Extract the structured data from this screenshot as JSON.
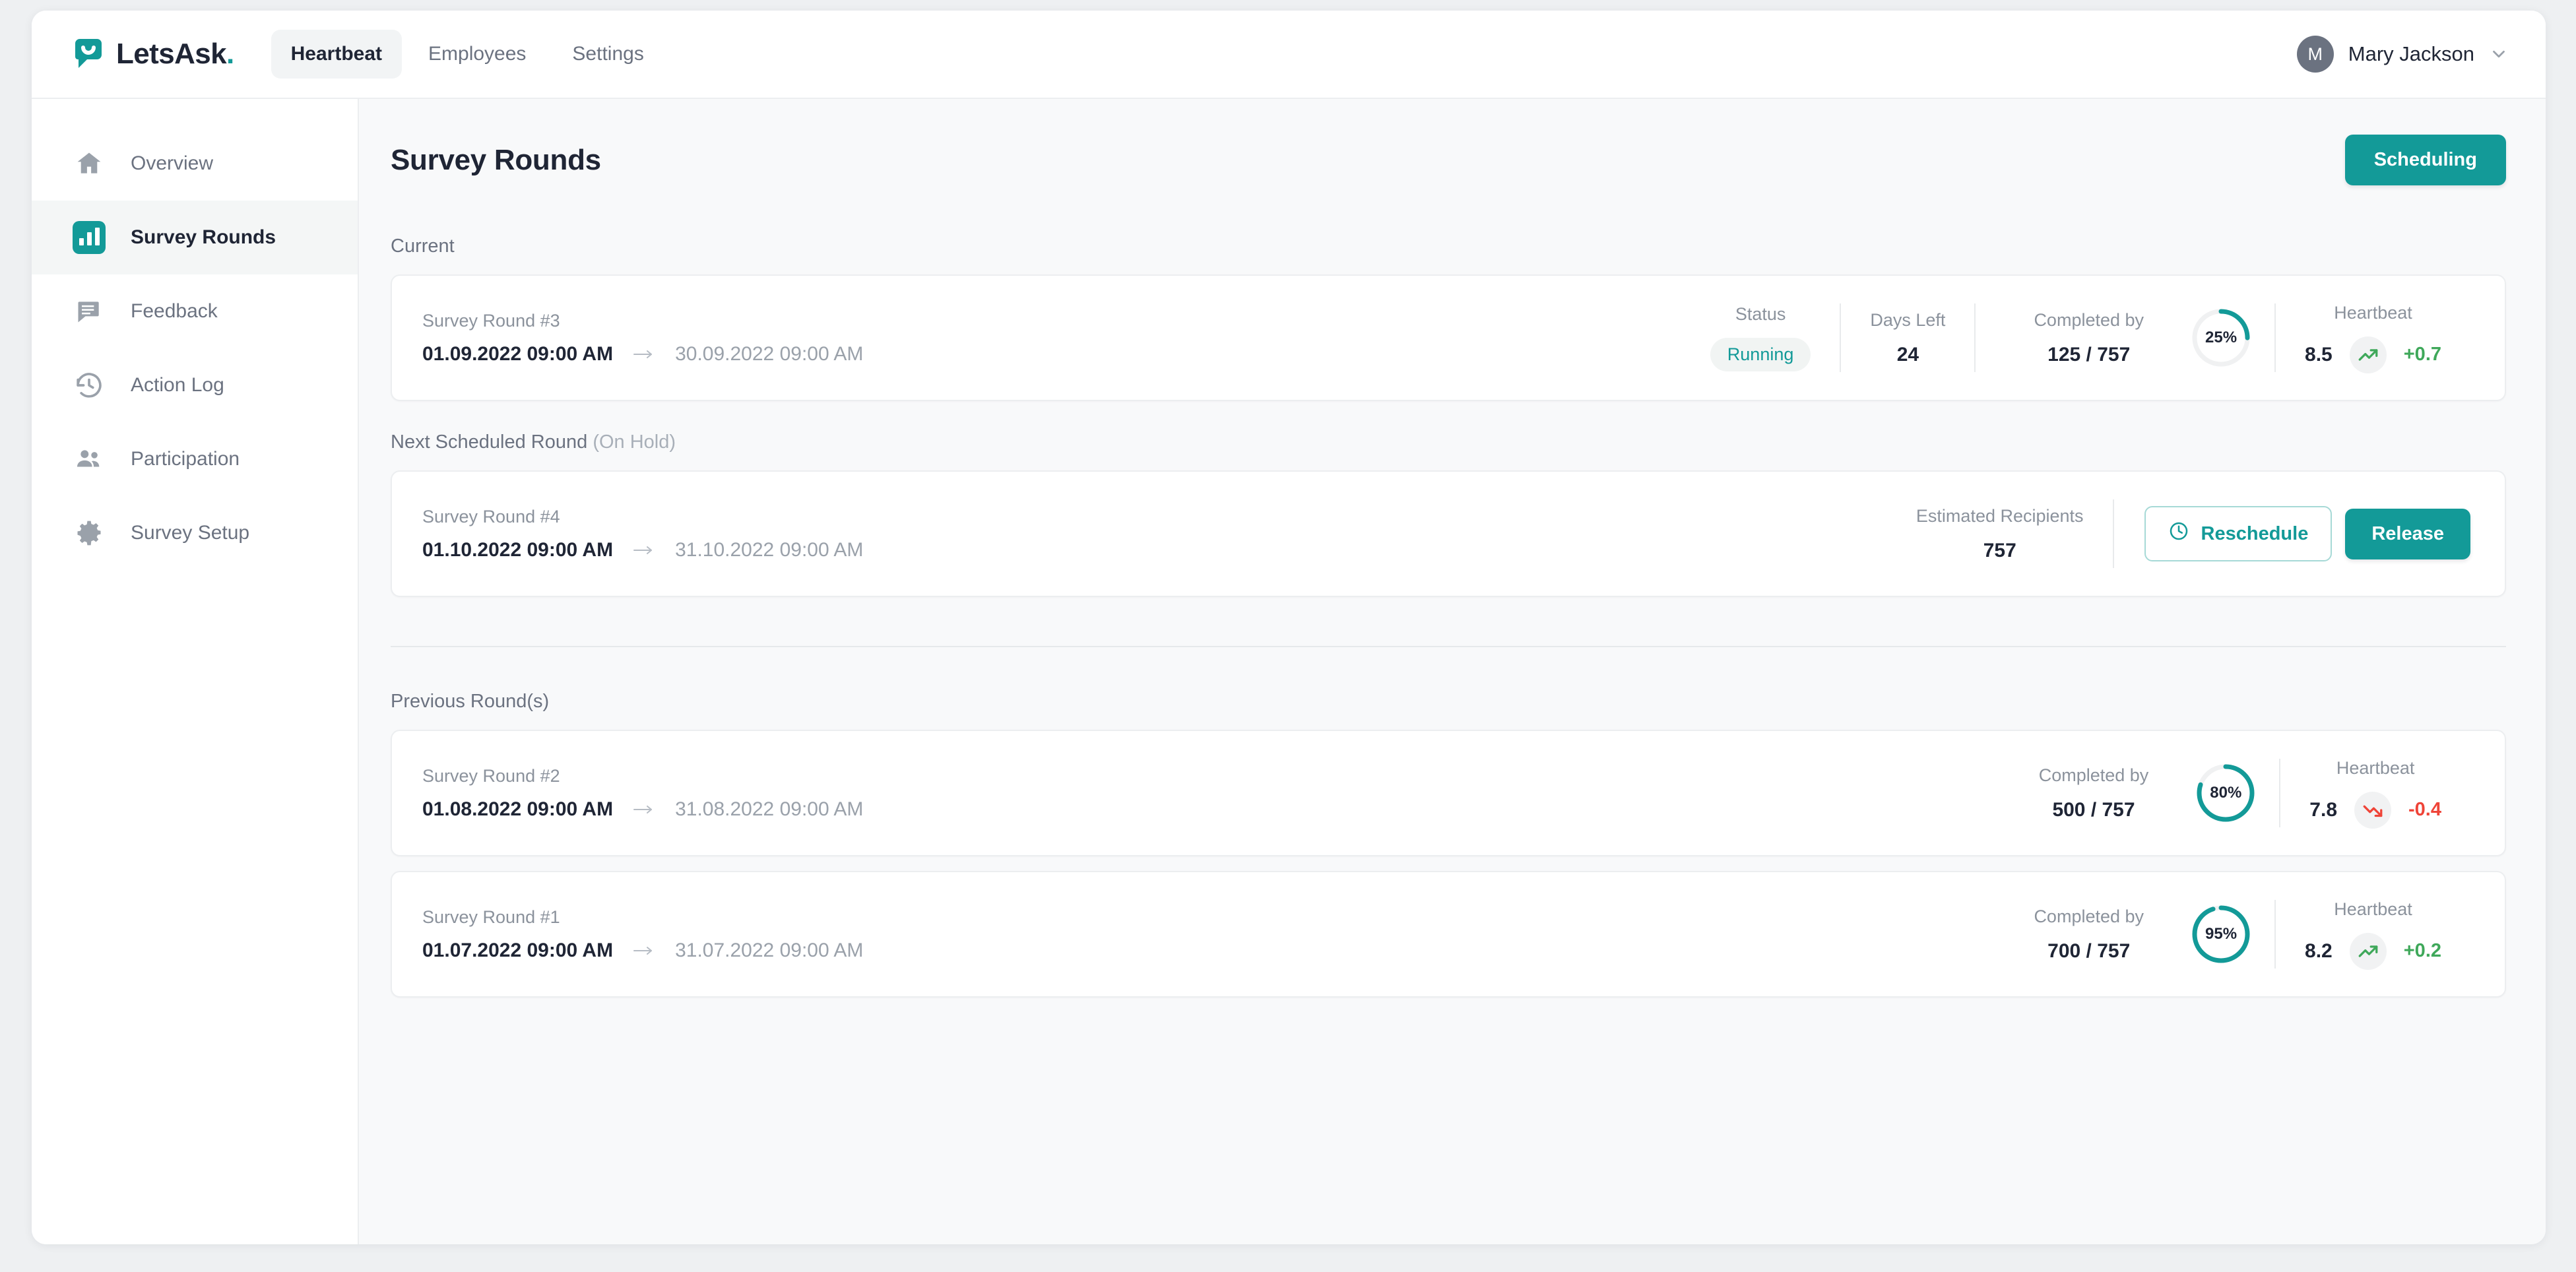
{
  "brand": {
    "name": "LetsAsk",
    "dot": ".",
    "logo_icon": "speech-bubble-smile-icon"
  },
  "nav": {
    "tabs": [
      {
        "label": "Heartbeat",
        "active": true
      },
      {
        "label": "Employees",
        "active": false
      },
      {
        "label": "Settings",
        "active": false
      }
    ]
  },
  "user": {
    "initial": "M",
    "name": "Mary Jackson",
    "chevron_icon": "chevron-down-icon"
  },
  "sidebar": {
    "items": [
      {
        "label": "Overview",
        "icon": "home-icon",
        "active": false
      },
      {
        "label": "Survey Rounds",
        "icon": "bar-chart-icon",
        "active": true
      },
      {
        "label": "Feedback",
        "icon": "comment-icon",
        "active": false
      },
      {
        "label": "Action Log",
        "icon": "history-clock-icon",
        "active": false
      },
      {
        "label": "Participation",
        "icon": "people-icon",
        "active": false
      },
      {
        "label": "Survey Setup",
        "icon": "gear-icon",
        "active": false
      }
    ]
  },
  "page": {
    "title": "Survey Rounds",
    "scheduling_button": "Scheduling"
  },
  "colors": {
    "accent_teal": "#139a98",
    "positive_green": "#3fa85a",
    "negative_red": "#ef4438",
    "track_gray": "#f0f1f2"
  },
  "sections": {
    "current": {
      "label": "Current",
      "round": {
        "name": "Survey Round #3",
        "date_from": "01.09.2022 09:00 AM",
        "date_to": "30.09.2022 09:00 AM",
        "arrow_icon": "arrow-right-icon",
        "status_label": "Status",
        "status_value": "Running",
        "days_left_label": "Days Left",
        "days_left_value": "24",
        "completed_label": "Completed by",
        "completed_value": "125 / 757",
        "completed_percent": 25,
        "completed_percent_text": "25%",
        "heartbeat_label": "Heartbeat",
        "heartbeat_value": "8.5",
        "heartbeat_delta": "+0.7",
        "heartbeat_trend": "up",
        "trend_icon": "trending-up-icon"
      }
    },
    "next": {
      "label": "Next Scheduled Round",
      "label_suffix": "(On Hold)",
      "round": {
        "name": "Survey Round #4",
        "date_from": "01.10.2022 09:00 AM",
        "date_to": "31.10.2022 09:00 AM",
        "arrow_icon": "arrow-right-icon",
        "recipients_label": "Estimated Recipients",
        "recipients_value": "757",
        "reschedule_button": "Reschedule",
        "reschedule_icon": "clock-icon",
        "release_button": "Release"
      }
    },
    "previous": {
      "label": "Previous Round(s)",
      "rounds": [
        {
          "name": "Survey Round #2",
          "date_from": "01.08.2022 09:00 AM",
          "date_to": "31.08.2022 09:00 AM",
          "arrow_icon": "arrow-right-icon",
          "completed_label": "Completed by",
          "completed_value": "500 / 757",
          "completed_percent": 80,
          "completed_percent_text": "80%",
          "heartbeat_label": "Heartbeat",
          "heartbeat_value": "7.8",
          "heartbeat_delta": "-0.4",
          "heartbeat_trend": "down",
          "trend_icon": "trending-down-icon"
        },
        {
          "name": "Survey Round #1",
          "date_from": "01.07.2022 09:00 AM",
          "date_to": "31.07.2022 09:00 AM",
          "arrow_icon": "arrow-right-icon",
          "completed_label": "Completed by",
          "completed_value": "700 / 757",
          "completed_percent": 95,
          "completed_percent_text": "95%",
          "heartbeat_label": "Heartbeat",
          "heartbeat_value": "8.2",
          "heartbeat_delta": "+0.2",
          "heartbeat_trend": "up",
          "trend_icon": "trending-up-icon"
        }
      ]
    }
  }
}
